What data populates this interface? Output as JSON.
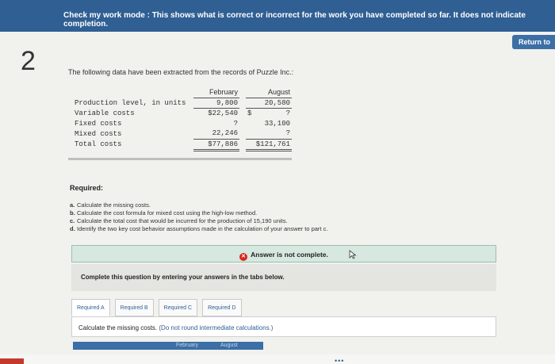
{
  "banner": {
    "text": "Check my work mode : This shows what is correct or incorrect for the work you have completed so far. It does not indicate completion."
  },
  "return_label": "Return to",
  "question_number": "2",
  "intro": "The following data have been extracted from the records of Puzzle Inc.:",
  "data_table": {
    "headers": [
      "February",
      "August"
    ],
    "rows": [
      {
        "label": "Production level, in units",
        "feb": "9,800",
        "aug": "20,580"
      },
      {
        "label": "Variable costs",
        "feb": "$22,540",
        "aug_prefix": "$",
        "aug": "?"
      },
      {
        "label": "Fixed costs",
        "feb": "?",
        "aug": "33,100"
      },
      {
        "label": "Mixed costs",
        "feb": "22,246",
        "aug": "?"
      },
      {
        "label": "Total costs",
        "feb": "$77,886",
        "aug": "$121,761"
      }
    ]
  },
  "required": {
    "title": "Required:",
    "items": [
      {
        "letter": "a.",
        "text": "Calculate the missing costs."
      },
      {
        "letter": "b.",
        "text": "Calculate the cost formula for mixed cost using the high-low method."
      },
      {
        "letter": "c.",
        "text": "Calculate the total cost that would be incurred for the production of 15,190 units."
      },
      {
        "letter": "d.",
        "text": "Identify the two key cost behavior assumptions made in the calculation of your answer to part c."
      }
    ]
  },
  "answer_status": "Answer is not complete.",
  "complete_instructions": "Complete this question by entering your answers in the tabs below.",
  "tabs": [
    "Required A",
    "Required B",
    "Required C",
    "Required D"
  ],
  "panel": {
    "text": "Calculate the missing costs.",
    "note": "(Do not round intermediate calculations.)"
  },
  "answer_table_headers": [
    "February",
    "August"
  ],
  "colors": {
    "banner": "#2f5f93",
    "accent": "#3b6fa6",
    "error": "#d9281b",
    "answer_box": "#d6e8df"
  }
}
